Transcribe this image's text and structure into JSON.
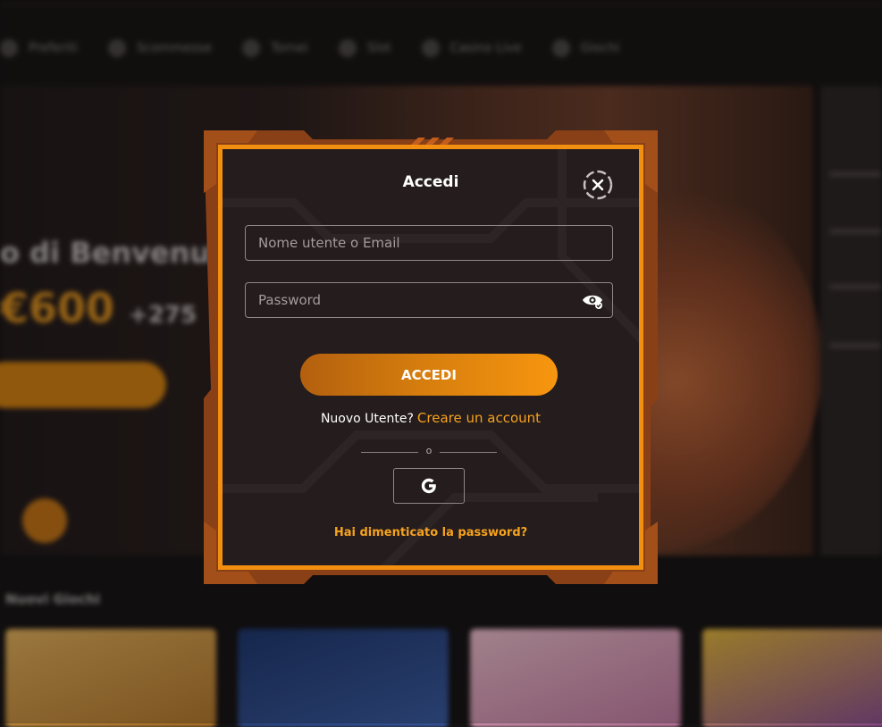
{
  "background": {
    "nav_items": [
      "Preferiti",
      "Scommesse",
      "Tornei",
      "Slot",
      "Casino Live",
      "Giochi"
    ],
    "hero_line1": "o di Benvenuto",
    "hero_amount": "€600",
    "hero_extra": "+275",
    "section_title": "Nuovi Giochi"
  },
  "login_modal": {
    "title": "Accedi",
    "username": {
      "placeholder": "Nome utente o Email",
      "value": ""
    },
    "password": {
      "placeholder": "Password",
      "value": ""
    },
    "submit_label": "ACCEDI",
    "register_prompt": "Nuovo Utente?",
    "register_link": "Creare un account",
    "divider_text": "o",
    "google_icon": "google-g-icon",
    "forgot_password": "Hai dimenticato la password?"
  },
  "colors": {
    "accent": "#f28f10",
    "link": "#f6a21e",
    "modal_bg": "#241c1d",
    "frame_dark": "#8a4016"
  }
}
